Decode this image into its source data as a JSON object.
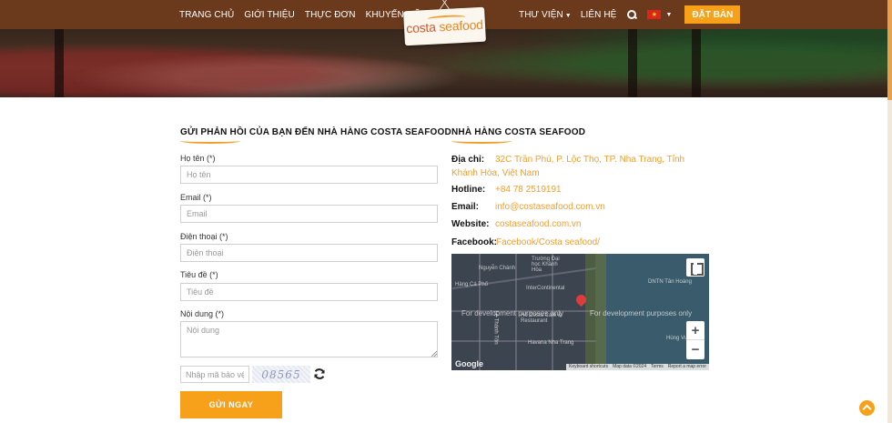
{
  "nav": {
    "left_items": [
      "TRANG CHỦ",
      "GIỚI THIỆU",
      "THỰC ĐƠN",
      "KHUYẾN MÃI"
    ],
    "right_items": [
      "THƯ VIỆN",
      "LIÊN HỆ"
    ],
    "book_label": "ĐẶT BÀN",
    "language_flag": "vietnam-flag"
  },
  "logo": {
    "word1": "costa",
    "word2": "seafood"
  },
  "form": {
    "heading": "GỬI PHẢN HỒI CỦA BẠN ĐẾN NHÀ HÀNG COSTA SEAFOOD",
    "fields": [
      {
        "label": "Họ tên (*)",
        "placeholder": "Họ tên"
      },
      {
        "label": "Email (*)",
        "placeholder": "Email"
      },
      {
        "label": "Điện thoại (*)",
        "placeholder": "Điện thoại"
      },
      {
        "label": "Tiêu đề (*)",
        "placeholder": "Tiêu đề"
      },
      {
        "label": "Nội dung (*)",
        "placeholder": "Nội dung"
      }
    ],
    "captcha_placeholder": "Nhập mã bảo vệ",
    "captcha_code": "08565",
    "submit_label": "GỬI NGAY"
  },
  "contact": {
    "heading": "NHÀ HÀNG COSTA SEAFOOD",
    "address_label": "Địa chỉ:",
    "address": "32C Trần Phú, P. Lộc Thọ, TP. Nha Trang, Tỉnh Khánh Hòa, Việt Nam",
    "hotline_label": "Hotline:",
    "hotline": "+84 78 2519191",
    "email_label": "Email:",
    "email": "info@costaseafood.com.vn",
    "website_label": "Website:",
    "website": "costaseafood.com.vn",
    "facebook_label": "Facebook:",
    "facebook": "Facebook/Costa seafood/"
  },
  "map": {
    "dev_text": "For development purposes only",
    "labels": [
      "Nguyễn Chánh",
      "Trường Đại học Khánh Hòa",
      "InterContinental",
      "Hàng Cá Phố",
      "Hồ Costa Café & Restaurant",
      "Havana Nha Trang",
      "DNTN Tân Hoàng",
      "Hùng Vương",
      "Lê Thánh Tôn"
    ],
    "google": "Google",
    "footer": [
      "Keyboard shortcuts",
      "Map data ©2024",
      "Terms",
      "Report a map error"
    ]
  },
  "colors": {
    "accent": "#f7a11a",
    "nav_bg": "#6b3a1c",
    "link": "#f29d2a"
  }
}
